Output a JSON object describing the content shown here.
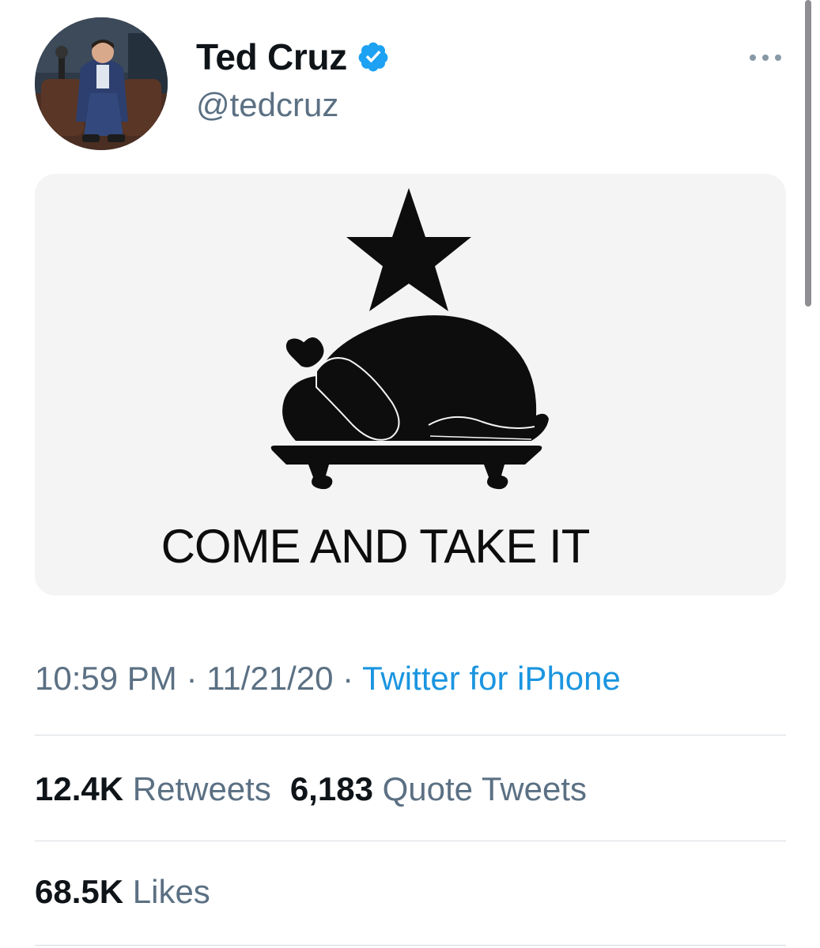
{
  "tweet": {
    "author": {
      "name": "Ted Cruz",
      "handle": "@tedcruz",
      "verified": true
    },
    "media": {
      "caption_text": "COME AND TAKE IT"
    },
    "meta": {
      "time": "10:59 PM",
      "date": "11/21/20",
      "separator": " · ",
      "source": "Twitter for iPhone"
    },
    "stats": {
      "retweets": {
        "count": "12.4K",
        "label": "Retweets"
      },
      "quote_tweets": {
        "count": "6,183",
        "label": "Quote Tweets"
      },
      "likes": {
        "count": "68.5K",
        "label": "Likes"
      }
    }
  },
  "icons": {
    "verified": "verified-badge-icon",
    "more": "more-horizontal-icon"
  },
  "colors": {
    "text_primary": "#0f1419",
    "text_secondary": "#5b7083",
    "link_blue": "#1b95e0",
    "verified_blue": "#1da1f2",
    "divider": "#d6dbe0"
  }
}
